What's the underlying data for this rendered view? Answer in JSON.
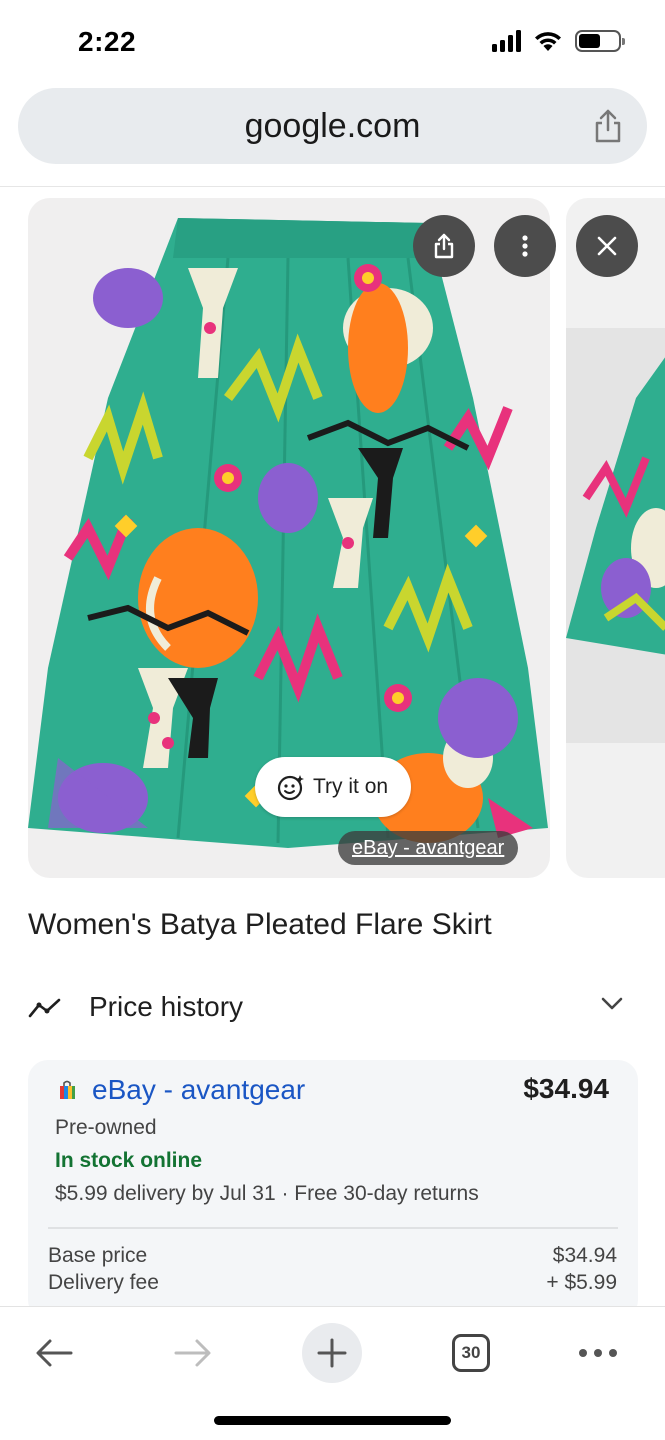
{
  "status_bar": {
    "time": "2:22"
  },
  "browser": {
    "url": "google.com",
    "tab_count": "30"
  },
  "image": {
    "try_it_on_label": "Try it on",
    "source_label": "eBay - avantgear"
  },
  "product": {
    "title": "Women's Batya Pleated Flare Skirt",
    "price_history_label": "Price history"
  },
  "offer": {
    "seller": "eBay - avantgear",
    "price": "$34.94",
    "condition": "Pre-owned",
    "stock": "In stock online",
    "delivery": "$5.99 delivery by Jul 31 · Free 30-day returns",
    "rows": [
      {
        "label": "Base price",
        "value": "$34.94"
      },
      {
        "label": "Delivery fee",
        "value": "+ $5.99"
      }
    ]
  },
  "colors": {
    "link_blue": "#1a56c4",
    "stock_green": "#137333",
    "skirt_teal": "#2fae8f"
  },
  "icons": [
    "share-icon",
    "more-vert-icon",
    "close-icon",
    "try-on-face-icon",
    "price-trend-icon",
    "chevron-down-icon",
    "shopping-bag-icon",
    "back-arrow-icon",
    "forward-arrow-icon",
    "plus-icon",
    "tabs-icon",
    "more-horiz-icon"
  ]
}
